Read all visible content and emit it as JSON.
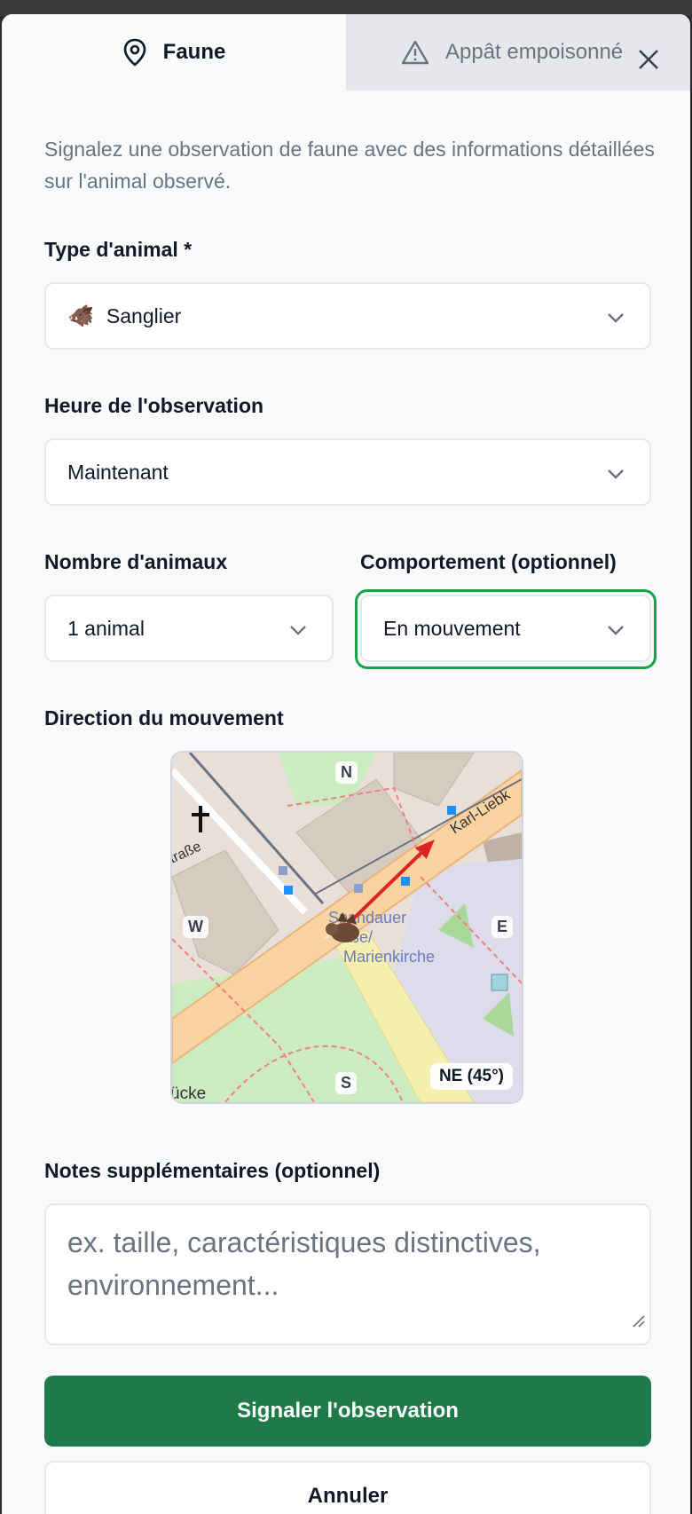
{
  "tabs": [
    {
      "label": "Faune",
      "icon": "map-pin-icon",
      "active": true
    },
    {
      "label": "Appât empoisonné",
      "icon": "warning-triangle-icon",
      "active": false
    }
  ],
  "intro": "Signalez une observation de faune avec des informations détaillées sur l'animal observé.",
  "animal_type": {
    "label": "Type d'animal *",
    "value": "Sanglier",
    "emoji": "🐗"
  },
  "observation_time": {
    "label": "Heure de l'observation",
    "value": "Maintenant"
  },
  "animal_count": {
    "label": "Nombre d'animaux",
    "value": "1 animal"
  },
  "behavior": {
    "label": "Comportement (optionnel)",
    "value": "En mouvement"
  },
  "direction": {
    "label": "Direction du mouvement",
    "compass": {
      "n": "N",
      "s": "S",
      "e": "E",
      "w": "W"
    },
    "readout": "NE (45°)",
    "angle_deg": 45,
    "map_labels": {
      "street1": "Karl-Liebk",
      "street2": "traße",
      "stop": "Spandauer",
      "stop2": "aße/",
      "stop3": "Marienkirche",
      "corner": "ücke"
    }
  },
  "notes": {
    "label": "Notes supplémentaires (optionnel)",
    "placeholder": "ex. taille, caractéristiques distinctives, environnement..."
  },
  "actions": {
    "submit": "Signaler l'observation",
    "cancel": "Annuler"
  },
  "colors": {
    "accent": "#1f7a4a",
    "focus": "#16a34a",
    "arrow": "#dc2626"
  }
}
